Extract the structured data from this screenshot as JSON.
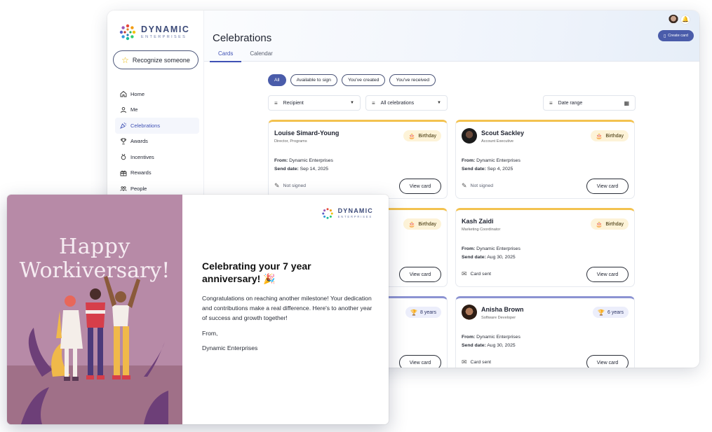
{
  "brand": {
    "name": "DYNAMIC",
    "sub": "ENTERPRISES"
  },
  "sidebar": {
    "recognize_label": "Recognize someone",
    "items": [
      {
        "label": "Home",
        "icon": "home-icon"
      },
      {
        "label": "Me",
        "icon": "person-icon"
      },
      {
        "label": "Celebrations",
        "icon": "party-icon",
        "active": true
      },
      {
        "label": "Awards",
        "icon": "trophy-icon"
      },
      {
        "label": "Incentives",
        "icon": "incentive-icon"
      },
      {
        "label": "Rewards",
        "icon": "gift-icon"
      },
      {
        "label": "People",
        "icon": "people-icon"
      }
    ]
  },
  "header": {
    "title": "Celebrations",
    "tabs": [
      {
        "label": "Cards",
        "active": true
      },
      {
        "label": "Calendar"
      }
    ],
    "create_label": "Create card"
  },
  "filters": {
    "chips": [
      {
        "label": "All",
        "selected": true
      },
      {
        "label": "Available to sign"
      },
      {
        "label": "You've created"
      },
      {
        "label": "You've received"
      }
    ],
    "recipient": "Recipient",
    "celebration_type": "All celebrations",
    "date_range": "Date range"
  },
  "cards": [
    {
      "name": "Louise Simard-Young",
      "role": "Director, Programs",
      "badge": "Birthday",
      "from_label": "From:",
      "from": "Dynamic Enterprises",
      "date_label": "Send date:",
      "date": "Sep 14, 2025",
      "status": "Not signed",
      "button": "View card"
    },
    {
      "name": "Scout Sackley",
      "role": "Account Executive",
      "badge": "Birthday",
      "from_label": "From:",
      "from": "Dynamic Enterprises",
      "date_label": "Send date:",
      "date": "Sep 4, 2025",
      "status": "Not signed",
      "button": "View card"
    },
    {
      "badge": "Birthday",
      "button": "View card"
    },
    {
      "name": "Kash Zaidi",
      "role": "Marketing Coordinator",
      "badge": "Birthday",
      "from_label": "From:",
      "from": "Dynamic Enterprises",
      "date_label": "Send date:",
      "date": "Aug 30, 2025",
      "status": "Card sent",
      "button": "View card"
    },
    {
      "badge": "8 years",
      "button": "View card"
    },
    {
      "name": "Anisha Brown",
      "role": "Software Developer",
      "badge": "6 years",
      "from_label": "From:",
      "from": "Dynamic Enterprises",
      "date_label": "Send date:",
      "date": "Aug 30, 2025",
      "status": "Card sent",
      "button": "View card"
    }
  ],
  "greeting": {
    "art_line1": "Happy",
    "art_line2": "Workiversary!",
    "title": "Celebrating your 7 year anniversary! 🎉",
    "body": "Congratulations on reaching another milestone! Your dedication and contributions make a real difference. Here's to another year of success and growth together!",
    "from_label": "From,",
    "signature": "Dynamic Enterprises"
  },
  "colors": {
    "accent": "#4a5caa",
    "birthday": "#f3c24f",
    "anniversary": "#8c93d2",
    "art_bg": "#b78aa7"
  }
}
